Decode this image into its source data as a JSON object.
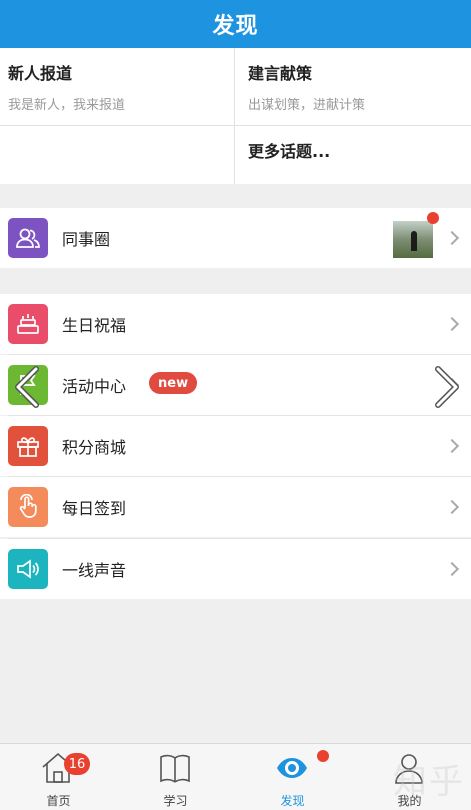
{
  "header": {
    "title": "发现"
  },
  "topics": [
    {
      "title": "新人报道",
      "subtitle": "我是新人，我来报道"
    },
    {
      "title": "建言献策",
      "subtitle": "出谋划策，进献计策"
    },
    {
      "title": "更多话题..."
    }
  ],
  "menu": {
    "colleague_circle": {
      "label": "同事圈",
      "icon": "people-icon",
      "color": "#7d52c1"
    },
    "items": [
      {
        "label": "生日祝福",
        "icon": "cake-icon",
        "color": "#ea4d6a"
      },
      {
        "label": "活动中心",
        "icon": "flag-icon",
        "color": "#6cb832",
        "badge": "new"
      },
      {
        "label": "积分商城",
        "icon": "gift-icon",
        "color": "#e2513c"
      },
      {
        "label": "每日签到",
        "icon": "hand-tap-icon",
        "color": "#f38b5a"
      },
      {
        "label": "一线声音",
        "icon": "speaker-icon",
        "color": "#1cb4be"
      }
    ]
  },
  "tabbar": {
    "items": [
      {
        "label": "首页",
        "icon": "home-icon",
        "badge": "16"
      },
      {
        "label": "学习",
        "icon": "book-icon"
      },
      {
        "label": "发现",
        "icon": "eye-icon",
        "active": true
      },
      {
        "label": "我的",
        "icon": "user-icon"
      }
    ]
  },
  "watermark": "知乎"
}
